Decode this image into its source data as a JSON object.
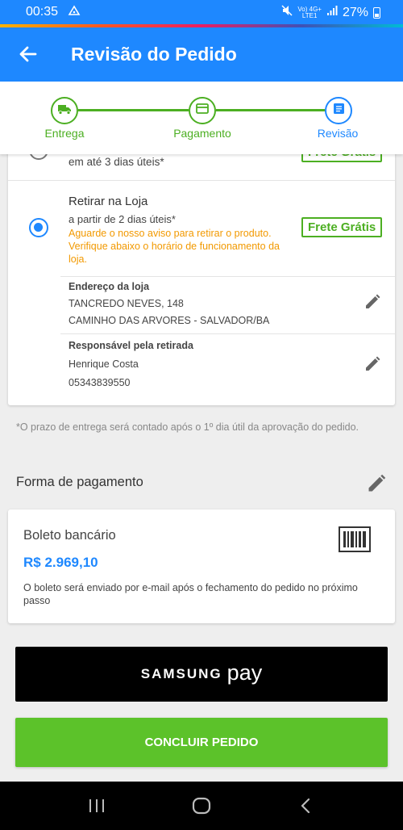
{
  "status_bar": {
    "time": "00:35",
    "network_label_top": "Vo) 4G+",
    "network_label_bottom": "LTE1",
    "battery": "27%"
  },
  "app_bar": {
    "title": "Revisão do Pedido",
    "back_icon": "arrow-back-icon"
  },
  "stepper": {
    "steps": [
      {
        "label": "Entrega",
        "icon": "truck-icon",
        "state": "done"
      },
      {
        "label": "Pagamento",
        "icon": "card-icon",
        "state": "done"
      },
      {
        "label": "Revisão",
        "icon": "document-icon",
        "state": "active"
      }
    ]
  },
  "delivery": {
    "partial_option": {
      "subtitle": "em até 3 dias úteis*",
      "badge": "Frete Grátis"
    },
    "store_pickup": {
      "title": "Retirar na Loja",
      "subtitle": "a partir de 2 dias úteis*",
      "notice": "Aguarde o nosso aviso para retirar o produto. Verifique abaixo o horário de funcionamento da loja.",
      "badge": "Frete Grátis",
      "address_label": "Endereço da loja",
      "address_line1": "TANCREDO NEVES, 148",
      "address_line2": "CAMINHO DAS ARVORES - SALVADOR/BA",
      "responsible_label": "Responsável pela retirada",
      "responsible_name": "Henrique Costa",
      "responsible_phone": "05343839550"
    },
    "footnote": "*O prazo de entrega será contado após o 1º dia útil da aprovação do pedido."
  },
  "payment": {
    "section_title": "Forma de pagamento",
    "method": "Boleto bancário",
    "amount": "R$ 2.969,10",
    "note": "O boleto será enviado por e-mail após o fechamento do pedido no próximo passo"
  },
  "buttons": {
    "samsung_pay_brand": "SAMSUNG",
    "samsung_pay_suffix": "pay",
    "finish": "CONCLUIR PEDIDO"
  },
  "colors": {
    "primary": "#1e88ff",
    "success": "#4caf22",
    "warning": "#f29900",
    "price": "#1e88ff"
  }
}
